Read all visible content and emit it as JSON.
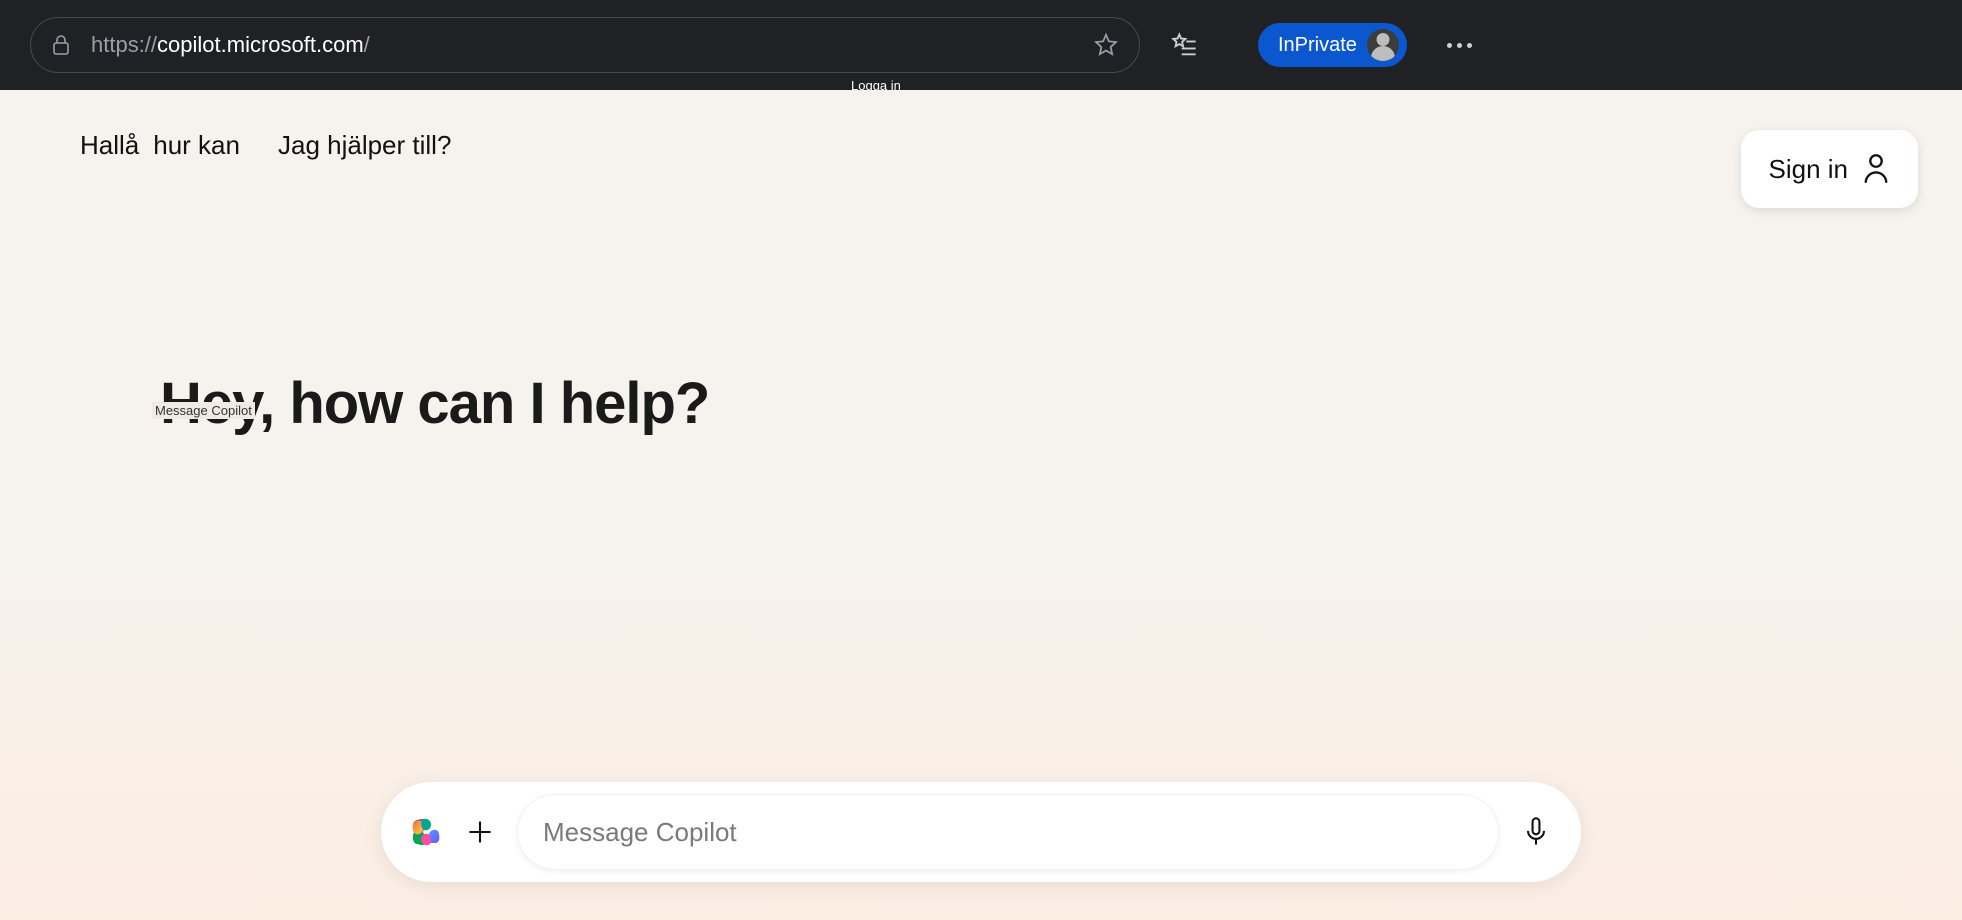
{
  "browser": {
    "url_scheme": "https://",
    "url_host": "copilot.microsoft.com",
    "url_path": "/",
    "inprivate_label": "InPrivate",
    "tooltip": "Logga in"
  },
  "page": {
    "translated_segment1": "Hallå",
    "translated_segment2": "hur kan",
    "translated_segment3": "Jag hjälper till?",
    "sign_in_label": "Sign in",
    "hero": "Hey, how can I help?",
    "hero_sublabel": "Message Copilot"
  },
  "composer": {
    "placeholder": "Message Copilot"
  }
}
